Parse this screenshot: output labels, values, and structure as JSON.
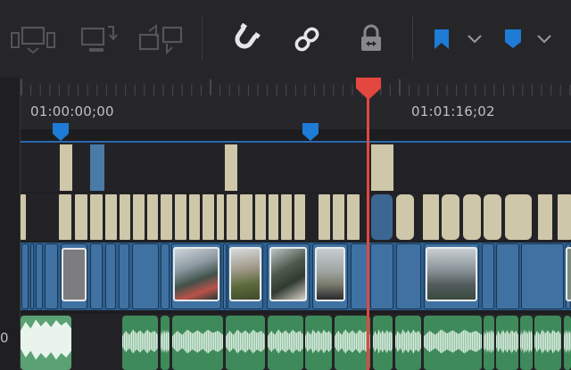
{
  "toolbar": {
    "icons": [
      "multicam-monitor-icon",
      "replace-clip-icon",
      "swap-clips-icon",
      "snapping-magnet-icon",
      "linked-selection-icon",
      "position-lock-icon",
      "flag-icon",
      "marker-icon"
    ],
    "accent": "#1e7bd6"
  },
  "ruler": {
    "timecode_start": "01:00:00;00",
    "timecode_next": "01:01:16;02"
  },
  "track": {
    "audio_label": "0"
  },
  "colors": {
    "playhead": "#e4473f",
    "video_clip": "#3f72a3",
    "subtitle_clip": "#cfc7aa",
    "audio_clip": "#3f8a5a",
    "marker": "#1e7bd6"
  }
}
